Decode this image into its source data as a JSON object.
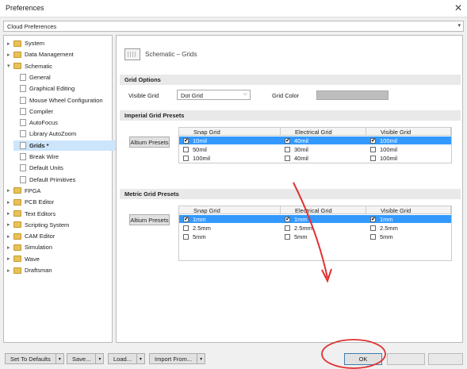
{
  "window": {
    "title": "Preferences"
  },
  "cloud": {
    "label": "Cloud Preferences"
  },
  "tree": [
    {
      "label": "System",
      "icon": "folder-icon",
      "level": 0,
      "expander": "▸"
    },
    {
      "label": "Data Management",
      "icon": "folder-icon",
      "level": 0,
      "expander": "▸"
    },
    {
      "label": "Schematic",
      "icon": "folder-icon",
      "level": 0,
      "expander": "▾"
    },
    {
      "label": "General",
      "icon": "page-icon",
      "level": 1,
      "expander": ""
    },
    {
      "label": "Graphical Editing",
      "icon": "page-icon",
      "level": 1,
      "expander": ""
    },
    {
      "label": "Mouse Wheel Configuration",
      "icon": "page-icon",
      "level": 1,
      "expander": ""
    },
    {
      "label": "Compiler",
      "icon": "page-icon",
      "level": 1,
      "expander": ""
    },
    {
      "label": "AutoFocus",
      "icon": "page-icon",
      "level": 1,
      "expander": ""
    },
    {
      "label": "Library AutoZoom",
      "icon": "page-icon",
      "level": 1,
      "expander": ""
    },
    {
      "label": "Grids *",
      "icon": "page-icon",
      "level": 1,
      "expander": "",
      "selected": true
    },
    {
      "label": "Break Wire",
      "icon": "page-icon",
      "level": 1,
      "expander": ""
    },
    {
      "label": "Default Units",
      "icon": "page-icon",
      "level": 1,
      "expander": ""
    },
    {
      "label": "Default Primitives",
      "icon": "page-icon",
      "level": 1,
      "expander": ""
    },
    {
      "label": "FPGA",
      "icon": "folder-icon",
      "level": 0,
      "expander": "▸"
    },
    {
      "label": "PCB Editor",
      "icon": "folder-icon",
      "level": 0,
      "expander": "▸"
    },
    {
      "label": "Text Editors",
      "icon": "folder-icon",
      "level": 0,
      "expander": "▸"
    },
    {
      "label": "Scripting System",
      "icon": "folder-icon",
      "level": 0,
      "expander": "▸"
    },
    {
      "label": "CAM Editor",
      "icon": "folder-icon",
      "level": 0,
      "expander": "▸"
    },
    {
      "label": "Simulation",
      "icon": "folder-icon",
      "level": 0,
      "expander": "▸"
    },
    {
      "label": "Wave",
      "icon": "folder-icon",
      "level": 0,
      "expander": "▸"
    },
    {
      "label": "Draftsman",
      "icon": "folder-icon",
      "level": 0,
      "expander": "▸"
    }
  ],
  "content": {
    "header": "Schematic – Grids",
    "grid_options": {
      "section": "Grid Options",
      "visible_grid_label": "Visible Grid",
      "visible_grid_value": "Dot Grid",
      "grid_color_label": "Grid Color",
      "grid_color": "#bdbdbd"
    },
    "imperial": {
      "section": "Imperial Grid Presets",
      "presets_button": "Altium Presets",
      "columns": [
        "Snap Grid",
        "Electrical Grid",
        "Visible Grid"
      ],
      "rows": [
        {
          "selected": true,
          "cells": [
            {
              "checked": true,
              "value": "10mil"
            },
            {
              "checked": true,
              "value": "40mil"
            },
            {
              "checked": true,
              "value": "100mil"
            }
          ]
        },
        {
          "selected": false,
          "cells": [
            {
              "checked": false,
              "value": "50mil"
            },
            {
              "checked": false,
              "value": "30mil"
            },
            {
              "checked": false,
              "value": "100mil"
            }
          ]
        },
        {
          "selected": false,
          "cells": [
            {
              "checked": false,
              "value": "100mil"
            },
            {
              "checked": false,
              "value": "40mil"
            },
            {
              "checked": false,
              "value": "100mil"
            }
          ]
        }
      ]
    },
    "metric": {
      "section": "Metric Grid Presets",
      "presets_button": "Altium Presets",
      "columns": [
        "Snap Grid",
        "Electrical Grid",
        "Visible Grid"
      ],
      "rows": [
        {
          "selected": true,
          "cells": [
            {
              "checked": true,
              "value": "1mm"
            },
            {
              "checked": true,
              "value": "1mm"
            },
            {
              "checked": true,
              "value": "1mm"
            }
          ]
        },
        {
          "selected": false,
          "cells": [
            {
              "checked": false,
              "value": "2.5mm"
            },
            {
              "checked": false,
              "value": "2.5mm"
            },
            {
              "checked": false,
              "value": "2.5mm"
            }
          ]
        },
        {
          "selected": false,
          "cells": [
            {
              "checked": false,
              "value": "5mm"
            },
            {
              "checked": false,
              "value": "5mm"
            },
            {
              "checked": false,
              "value": "5mm"
            }
          ]
        }
      ]
    }
  },
  "footer": {
    "set_defaults": "Set To Defaults",
    "save": "Save...",
    "load": "Load...",
    "import_from": "Import From...",
    "ok": "OK"
  },
  "colors": {
    "selection": "#3399ff",
    "annotation": "#e03030"
  }
}
